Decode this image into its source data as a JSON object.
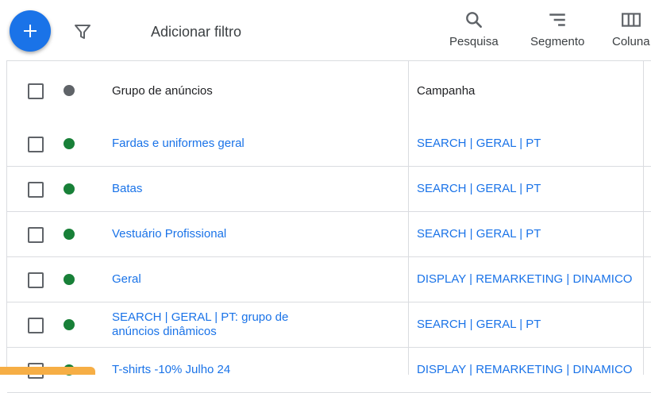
{
  "toolbar": {
    "add_filter_label": "Adicionar filtro",
    "tools": [
      {
        "label": "Pesquisa",
        "icon": "search-icon"
      },
      {
        "label": "Segmento",
        "icon": "segment-icon"
      },
      {
        "label": "Coluna",
        "icon": "columns-icon"
      }
    ]
  },
  "table": {
    "headers": {
      "ad_group": "Grupo de anúncios",
      "campaign": "Campanha"
    },
    "header_status_color": "#5f6368",
    "rows": [
      {
        "ad_group": "Fardas e uniformes geral",
        "campaign": "SEARCH | GERAL | PT",
        "status_color": "#188038"
      },
      {
        "ad_group": "Batas",
        "campaign": "SEARCH | GERAL | PT",
        "status_color": "#188038"
      },
      {
        "ad_group": "Vestuário Profissional",
        "campaign": "SEARCH | GERAL | PT",
        "status_color": "#188038"
      },
      {
        "ad_group": "Geral",
        "campaign": "DISPLAY | REMARKETING | DINAMICO",
        "status_color": "#188038"
      },
      {
        "ad_group": "SEARCH | GERAL | PT: grupo de anúncios dinâmicos",
        "campaign": "SEARCH | GERAL | PT",
        "status_color": "#188038"
      },
      {
        "ad_group": "T-shirts -10% Julho 24",
        "campaign": "DISPLAY | REMARKETING | DINAMICO",
        "status_color": "#188038"
      }
    ]
  },
  "colors": {
    "accent": "#1a73e8",
    "link": "#1a73e8",
    "enabled": "#188038"
  }
}
